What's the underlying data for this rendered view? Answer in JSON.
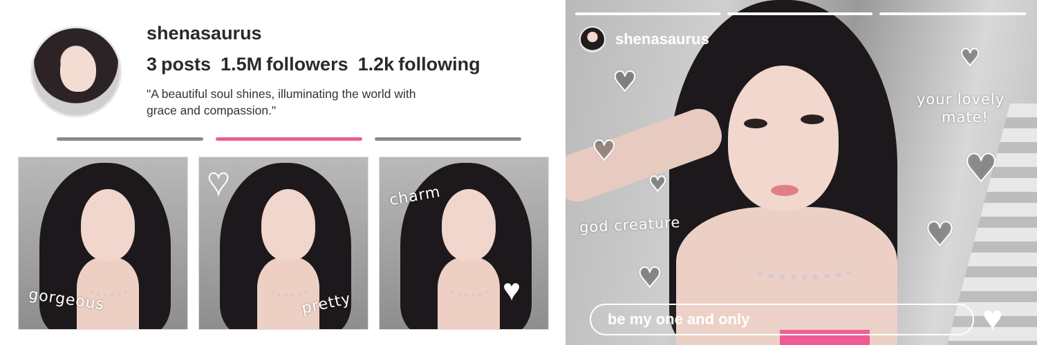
{
  "profile": {
    "username": "shenasaurus",
    "stats": [
      {
        "value": "3",
        "label": "posts"
      },
      {
        "value": "1.5M",
        "label": "followers"
      },
      {
        "value": "1.2k",
        "label": "following"
      }
    ],
    "bio_line1": "\"A beautiful soul shines, illuminating the world with",
    "bio_line2": "grace and compassion.\"",
    "active_tab_color": "#ec5d93",
    "tiles": [
      {
        "caption": "gorgeous"
      },
      {
        "caption": "pretty"
      },
      {
        "caption": "charm"
      }
    ]
  },
  "story": {
    "username": "shenasaurus",
    "stickers": [
      "your lovely",
      "mate!",
      "god creature"
    ],
    "reply_text": "be my one and only",
    "like_icon": "heart-icon"
  }
}
